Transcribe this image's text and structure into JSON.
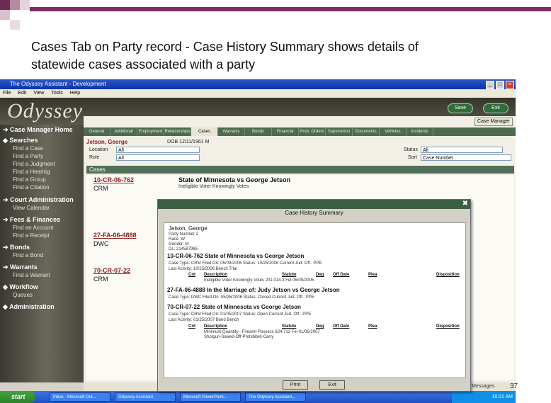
{
  "slide": {
    "title_line1": "Cases Tab on Party record - Case History Summary shows details of",
    "title_line2": "statewide cases associated with a party",
    "page_number": "37"
  },
  "window": {
    "title": "The Odyssey Assistant - Development",
    "menu": [
      "File",
      "Edit",
      "View",
      "Tools",
      "Help"
    ]
  },
  "banner": {
    "logo": "Odyssey",
    "save": "Save",
    "exit": "Exit"
  },
  "sidebar": [
    {
      "label": "Case Manager Home",
      "items": []
    },
    {
      "label": "Searches",
      "items": [
        "Find a Case",
        "Find a Party",
        "Find a Judgment",
        "Find a Hearing",
        "Find a Group",
        "Find a Citation"
      ]
    },
    {
      "label": "Court Administration",
      "items": [
        "View Calendar"
      ]
    },
    {
      "label": "Fees & Finances",
      "items": [
        "Find an Account",
        "Find a Receipt"
      ]
    },
    {
      "label": "Bonds",
      "items": [
        "Find a Bond"
      ]
    },
    {
      "label": "Warrants",
      "items": [
        "Find a Warrant"
      ]
    },
    {
      "label": "Workflow",
      "items": [
        "Queues"
      ]
    },
    {
      "label": "Administration",
      "items": []
    }
  ],
  "content": {
    "case_manager": "Case Manager",
    "tabs": [
      "General",
      "Additional",
      "Employment",
      "Relationships",
      "Cases",
      "Warrants",
      "Bonds",
      "Financial",
      "Prob. Orders",
      "Supervision",
      "Documents",
      "Vehicles",
      "Incidents"
    ],
    "party_name": "Jetson, George",
    "party_info": "DOB 12/11/1961   M",
    "location_label": "Location",
    "location_value": "All",
    "role_label": "Role",
    "role_value": "All",
    "status_label": "Status",
    "status_value": "All",
    "sort_label": "Sort",
    "sort_value": "Case Number",
    "cases_header": "Cases",
    "cases": [
      {
        "number": "10-CR-06-762",
        "type": "CRM",
        "title": "State of Minnesota vs George Jetson",
        "sub": "Ineligible Voter Knowingly Votes"
      },
      {
        "number": "27-FA-06-4888",
        "type": "DWC",
        "title": "",
        "sub": ""
      },
      {
        "number": "70-CR-07-22",
        "type": "CRM",
        "title": "",
        "sub": ""
      }
    ],
    "messages": "Messages"
  },
  "modal": {
    "title": "Case History Summary",
    "party_name": "Jetson, George",
    "party_lines": [
      "Party Number 2",
      "Race: W",
      "Gender: M",
      "DL: 214587985"
    ],
    "cases": [
      {
        "heading": "10-CR-06-762  State of Minnesota vs George Jetson",
        "detail": "Case Type: CRM      Filed On: 05/09/2006      Status: 10/25/2006      Current Jud. Off.: PPE",
        "activity": "Last Activity: 10/25/2006   Bench Trial",
        "rows": [
          "Ineligible Voter Knowingly Votes   201.014.3   Fel   05/09/2006"
        ]
      },
      {
        "heading": "27-FA-06-4888  In the Marriage of: Judy Jetson vs George Jetson",
        "detail": "Case Type: DWC      Filed On: 05/26/2006      Status: Closed      Current Jud. Off.: PPE",
        "activity": "",
        "rows": []
      },
      {
        "heading": "70-CR-07-22  State of Minnesota vs George Jetson",
        "detail": "Case Type: CRM      Filed On: 01/05/2007      Status: Open      Current Jud. Off.: PPE",
        "activity": "Last Activity: 01/25/2007   Bond Bench",
        "rows": [
          "Minimum Quantity - Firearm Possess   624.713   Fel   01/05/2007",
          "Shotgun-Sawed-Off-Prohibited-Carry"
        ]
      }
    ],
    "cols": [
      "Cnt",
      "Description",
      "Statute",
      "Deg",
      "Off Date",
      "Plea",
      "Disposition"
    ],
    "print": "Print",
    "exit": "Exit"
  },
  "taskbar": {
    "start": "start",
    "tasks": [
      "Inbox - Microsoft Out...",
      "Odyssey Assistant",
      "Microsoft PowerPoint...",
      "The Odyssey Assistant..."
    ],
    "clock": "10:21 AM"
  }
}
